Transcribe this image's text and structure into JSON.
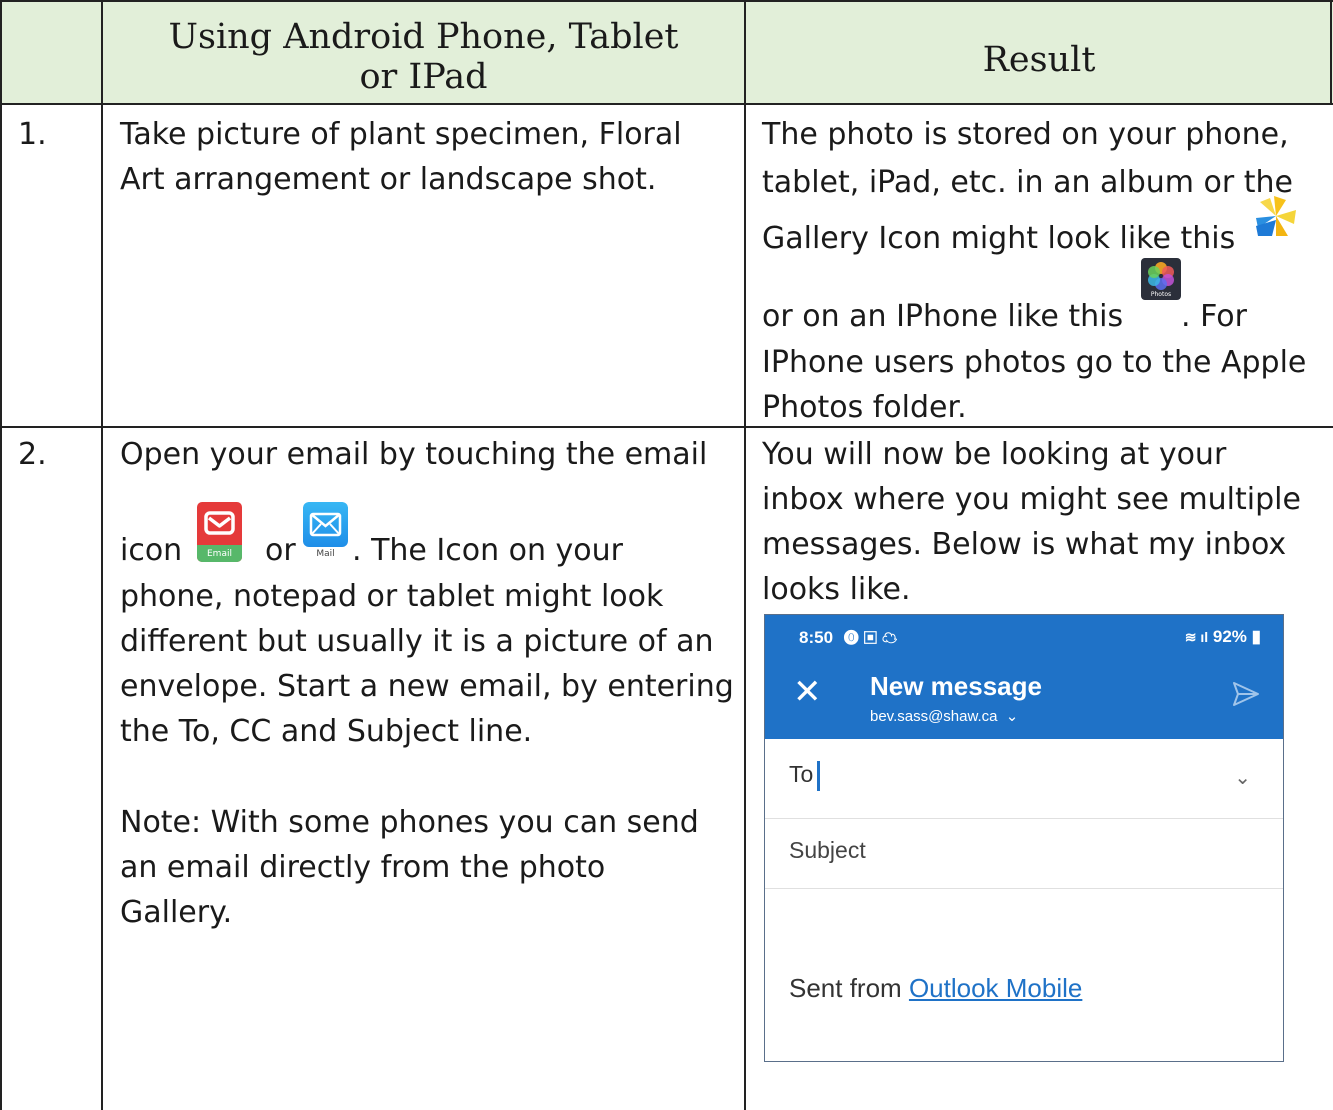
{
  "header": {
    "col1": "Using Android Phone, Tablet or IPad",
    "col1_line1": "Using Android Phone, Tablet",
    "col1_line2": "or IPad",
    "col2": "Result"
  },
  "rows": [
    {
      "num": "1.",
      "instruction_lines": [
        "Take picture of plant specimen, Floral",
        "Art arrangement or landscape shot."
      ],
      "result_lines": [
        "The photo is stored on your phone,",
        "tablet, iPad, etc. in an album or the",
        "Gallery Icon might look like this",
        "or on an IPhone like this",
        ".  For",
        "IPhone users photos go to the Apple",
        "Photos folder."
      ],
      "photos_icon_label": "Photos"
    },
    {
      "num": "2.",
      "instruction_lines": [
        "Open your email by touching the email",
        "icon",
        "or",
        ".  The Icon on your",
        "phone, notepad or tablet might look",
        "different but usually it is a picture of an",
        "envelope. Start a new email, by entering",
        "the To, CC and Subject line.",
        "Note: With some phones you can send",
        "an email directly from the photo",
        "Gallery."
      ],
      "email_icon_label": "Email",
      "mail_icon_label": "Mail",
      "result_lines": [
        "You will now be looking at your",
        "inbox where you might see multiple",
        "messages.  Below is what my inbox",
        "looks like."
      ]
    }
  ],
  "phone": {
    "time": "8:50",
    "battery": "92%",
    "title": "New message",
    "account": "bev.sass@shaw.ca",
    "to_label": "To",
    "subject_label": "Subject",
    "sent_prefix": "Sent from ",
    "sent_link": "Outlook Mobile",
    "accent": "#1f72c7"
  },
  "colors": {
    "header_bg": "#e2efd9"
  }
}
